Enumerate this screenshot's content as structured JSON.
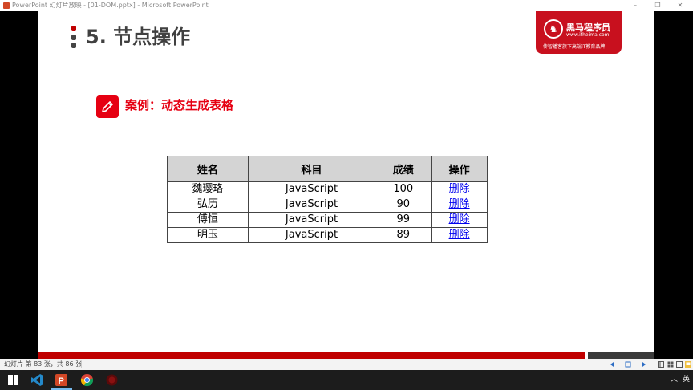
{
  "window": {
    "title": "PowerPoint 幻灯片放映 - [01-DOM.pptx] - Microsoft PowerPoint",
    "controls": [
      "–",
      "❐",
      "✕"
    ]
  },
  "slide": {
    "title": "5. 节点操作",
    "brand": {
      "name": "黑马程序员",
      "url": "www.itheima.com",
      "slogan": "传智播客旗下高端IT教育品牌"
    },
    "case_title": "案例：动态生成表格",
    "table": {
      "headers": [
        "姓名",
        "科目",
        "成绩",
        "操作"
      ],
      "rows": [
        [
          "魏璎珞",
          "JavaScript",
          "100",
          "删除"
        ],
        [
          "弘历",
          "JavaScript",
          "90",
          "删除"
        ],
        [
          "傅恒",
          "JavaScript",
          "99",
          "删除"
        ],
        [
          "明玉",
          "JavaScript",
          "89",
          "删除"
        ]
      ]
    }
  },
  "statusbar": {
    "slide_count": "幻灯片 第 83 张，共 86 张"
  },
  "taskbar": {
    "ime": "英"
  },
  "colors": {
    "brand_red": "#c8101e",
    "accent_red": "#e60012",
    "footer_red": "#c00000",
    "header_gray": "#d4d4d4"
  }
}
